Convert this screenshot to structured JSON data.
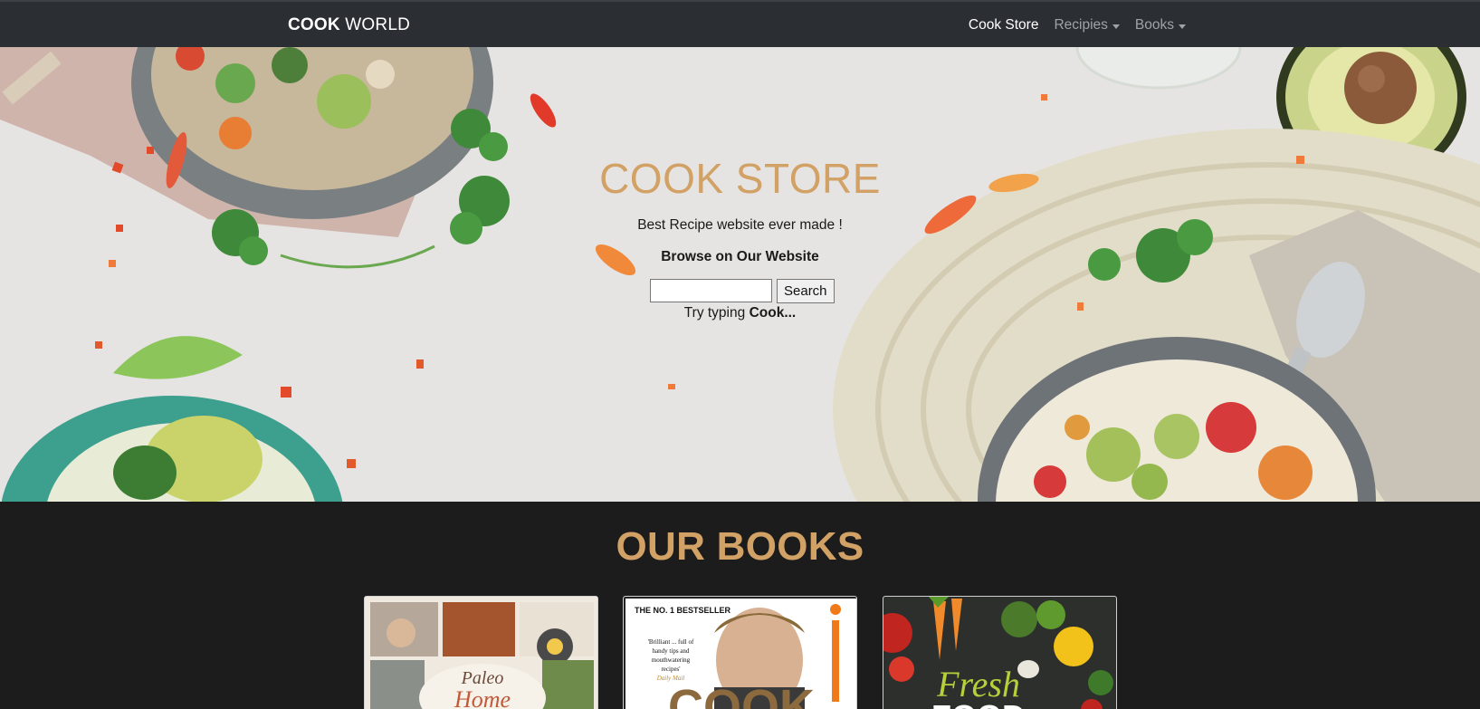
{
  "navbar": {
    "brand_bold": "COOK",
    "brand_rest": "WORLD",
    "items": [
      {
        "label": "Cook Store",
        "dropdown": false,
        "active": true
      },
      {
        "label": "Recipies",
        "dropdown": true,
        "active": false
      },
      {
        "label": "Books",
        "dropdown": true,
        "active": false
      }
    ]
  },
  "hero": {
    "title": "COOK STORE",
    "tagline": "Best Recipe website ever made !",
    "browse": "Browse on Our Website",
    "search_value": "",
    "search_button": "Search",
    "hint_prefix": "Try typing",
    "hint_bold": "Cook..."
  },
  "books": {
    "title": "OUR BOOKS",
    "items": [
      {
        "cover_text": "Paleo Home Cooking"
      },
      {
        "cover_top": "THE NO. 1 BESTSELLER",
        "cover_quote": "'Brilliant ... full of handy tips and mouthwatering recipes'",
        "cover_source": "Daily Mail",
        "cover_big": "COOK"
      },
      {
        "cover_text": "Fresh FOOD"
      }
    ]
  },
  "colors": {
    "accent": "#d2a165",
    "navbar": "#2b2f34",
    "dark_bg": "#1c1c1c"
  }
}
